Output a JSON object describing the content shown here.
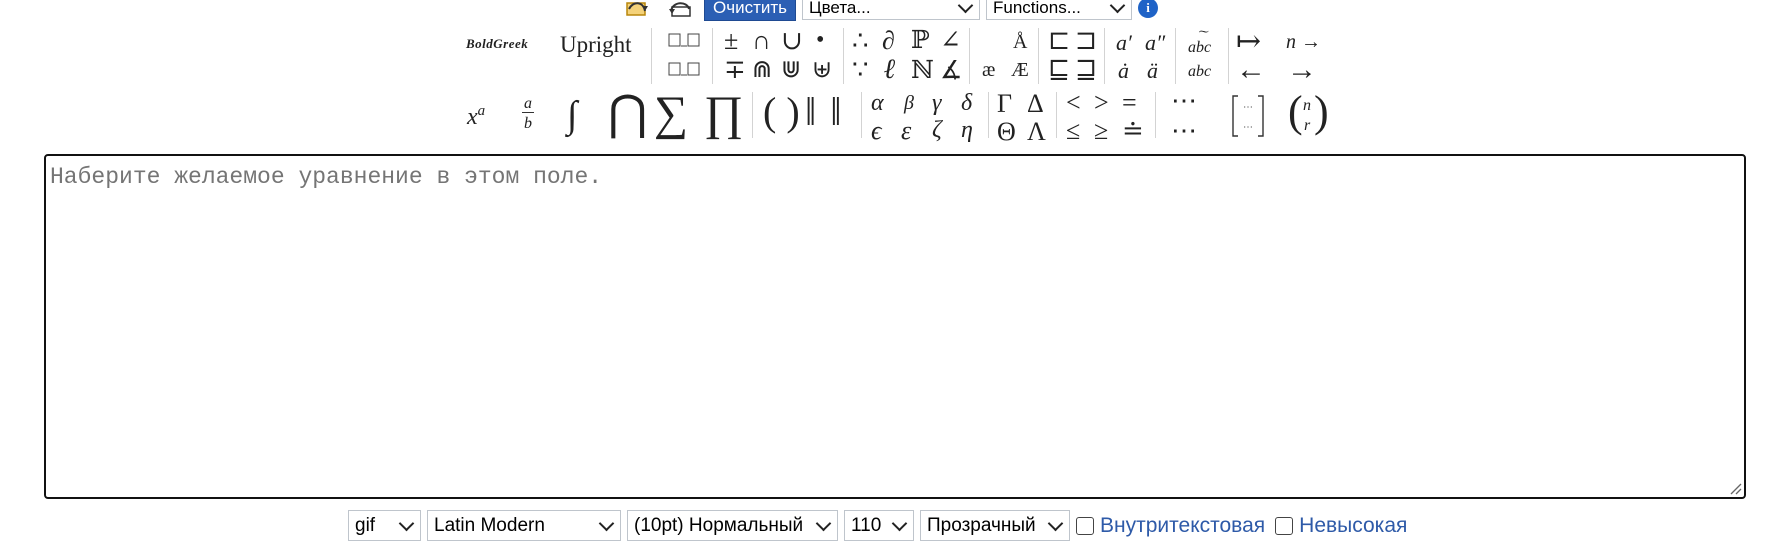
{
  "top_bar": {
    "undo_icon": "undo-icon",
    "redo_icon": "redo-icon",
    "clear_label": "Очистить",
    "colors_select": "Цвета...",
    "functions_select": "Functions...",
    "info_icon": "info-icon",
    "accent": "#2b5fb4"
  },
  "toolbar": {
    "font_style_bold_greek": "BoldGreek",
    "font_style_upright": "Upright",
    "binary_ops_row1": [
      "±",
      "∩",
      "∪",
      "•"
    ],
    "binary_ops_row2": [
      "∓",
      "⋒",
      "⋓",
      "⊎"
    ],
    "relations_row1": [
      "∴",
      "∂",
      "ℙ",
      "∠"
    ],
    "relations_row2": [
      "∵",
      "ℓ",
      "ℕ",
      "∡"
    ],
    "ligatures": [
      "æ",
      "Æ"
    ],
    "accent_letters": [
      "Å",
      "Æ"
    ],
    "subsets_row1": [
      "⊏",
      "⊐"
    ],
    "subsets_row2": [
      "⊑",
      "⊒"
    ],
    "primes_row1": [
      "a′",
      "a″"
    ],
    "primes_row2": [
      "ȧ",
      "ä"
    ],
    "wide_accents": [
      "abc",
      "abc"
    ],
    "arrows_row1": [
      "↦",
      "n →"
    ],
    "arrows_row2": [
      "←",
      "→"
    ],
    "big_superscript": "a",
    "big_superscript_base": "x",
    "big_frac_num": "a",
    "big_frac_den": "b",
    "big_integral": "∫",
    "big_cap": "⋂",
    "big_sum": "∑",
    "big_prod": "∏",
    "brackets": "( )",
    "norms": "‖ ‖",
    "greek_row1": [
      "α",
      "β",
      "γ",
      "δ"
    ],
    "greek_row2": [
      "ϵ",
      "ε",
      "ζ",
      "η"
    ],
    "greek_upper_row1": [
      "Γ",
      "Δ"
    ],
    "greek_upper_row2": [
      "Θ",
      "Λ"
    ],
    "compare_row1": [
      "<",
      ">",
      "="
    ],
    "compare_row2": [
      "≤",
      "≥",
      "≐"
    ],
    "dots_row1": "⋯",
    "dots_row2": "⋯",
    "binomial_n": "n",
    "binomial_r": "r"
  },
  "editor": {
    "placeholder": "Наберите желаемое уравнение в этом поле."
  },
  "bottom_bar": {
    "format": "gif",
    "font": "Latin Modern",
    "size": "(10pt) Нормальный",
    "resolution": "110",
    "background": "Прозрачный",
    "inline_label": "Внутритекстовая",
    "compressed_label": "Невысокая"
  }
}
